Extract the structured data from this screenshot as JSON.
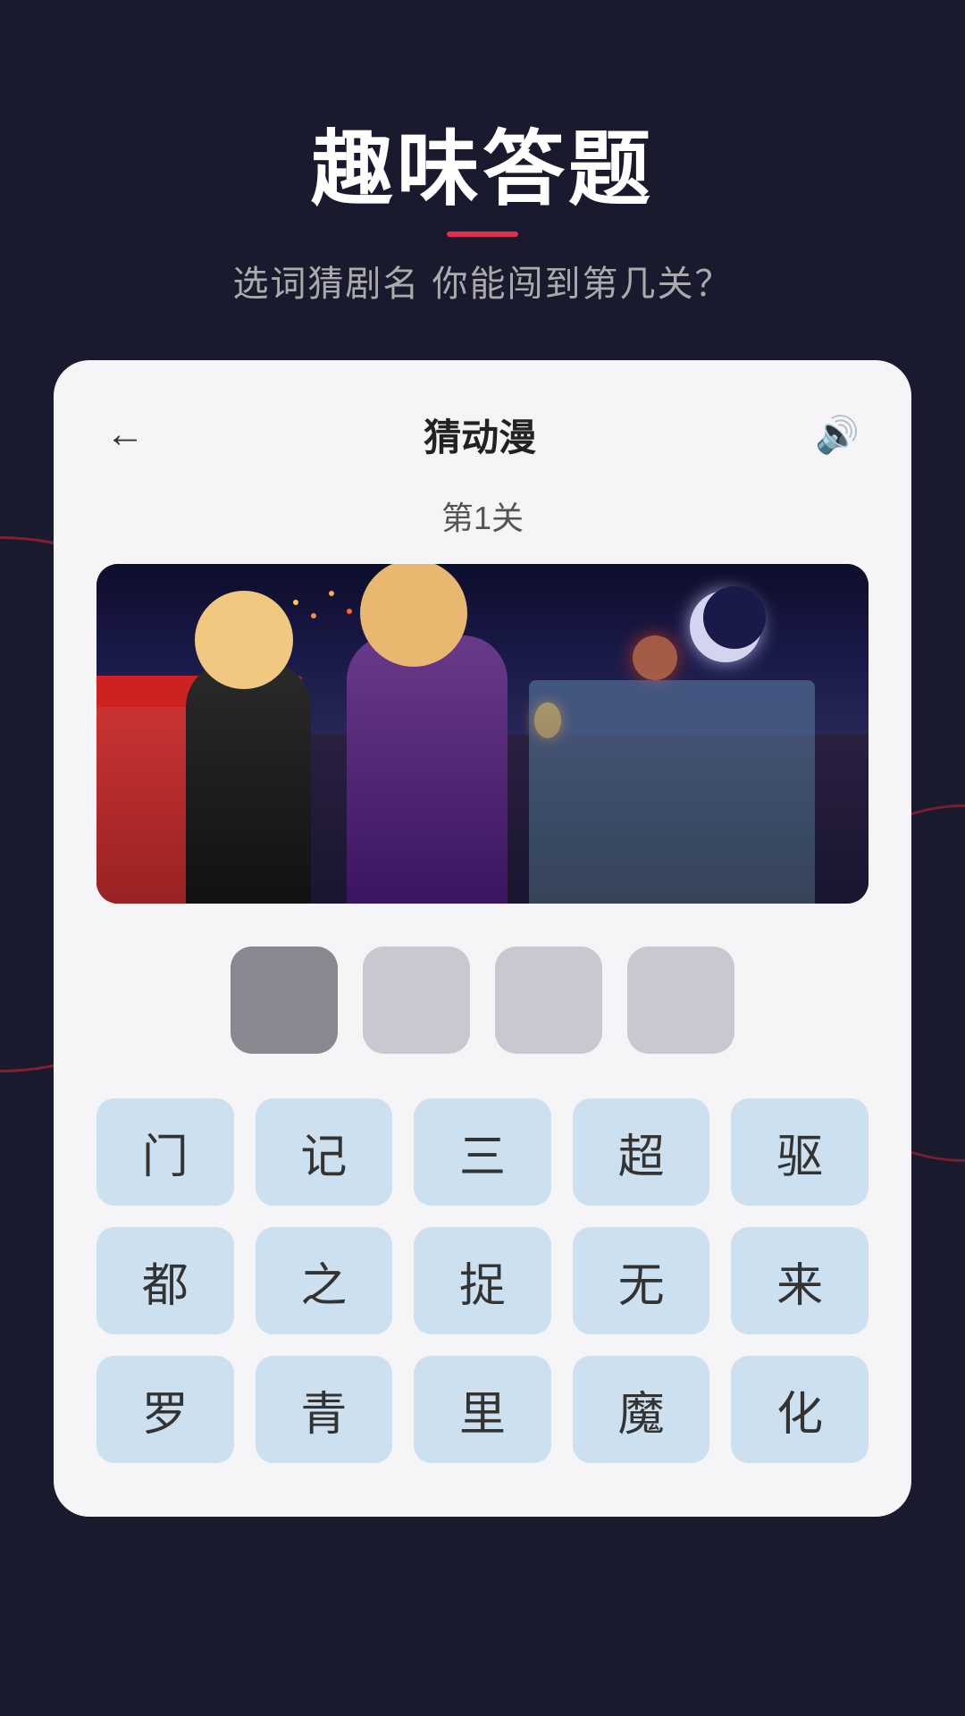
{
  "app": {
    "background_color": "#1a1a2e"
  },
  "header": {
    "title": "趣味答题",
    "subtitle": "选词猜剧名 你能闯到第几关？",
    "underline_color": "#e03050"
  },
  "card": {
    "category_title": "猜动漫",
    "level_label": "第1关",
    "back_icon": "←",
    "volume_icon": "🔊"
  },
  "answer_slots": [
    {
      "id": 1,
      "filled": true
    },
    {
      "id": 2,
      "filled": false
    },
    {
      "id": 3,
      "filled": false
    },
    {
      "id": 4,
      "filled": false
    }
  ],
  "word_buttons": {
    "row1": [
      "门",
      "记",
      "三",
      "超",
      "驱"
    ],
    "row2": [
      "都",
      "之",
      "捉",
      "无",
      "来"
    ],
    "row3": [
      "罗",
      "青",
      "里",
      "魔",
      "化"
    ]
  }
}
